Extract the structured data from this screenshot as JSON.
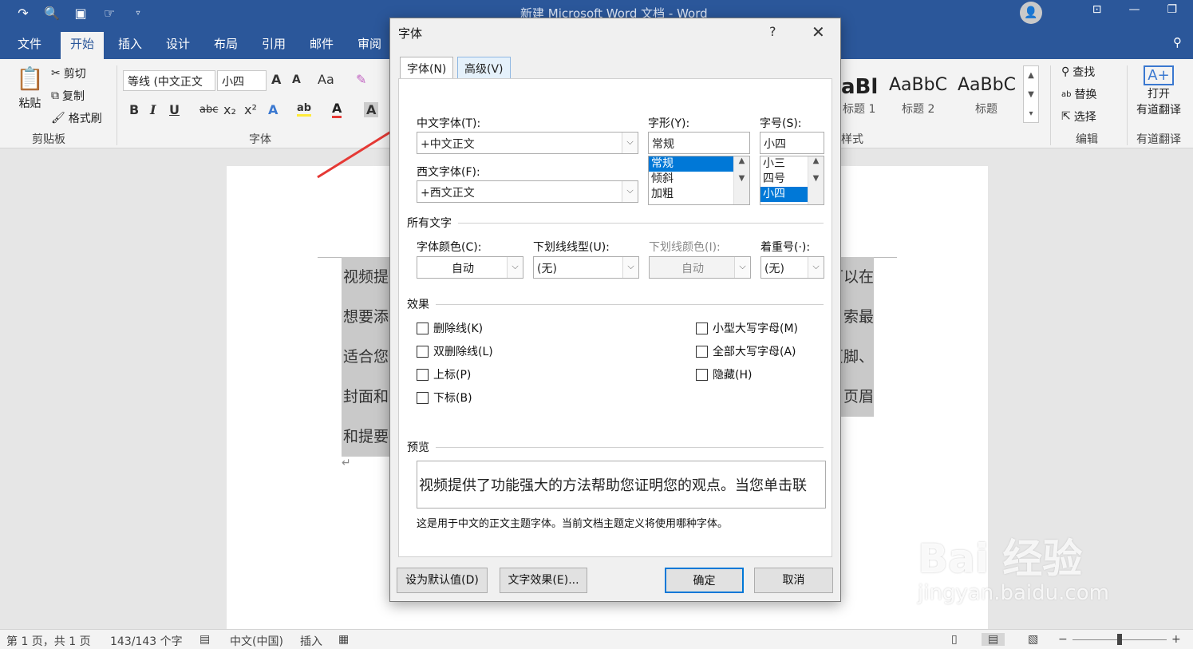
{
  "window": {
    "title": "新建 Microsoft Word 文档  -  Word",
    "qat_icons": [
      "redo-icon",
      "print-preview-icon",
      "save-icon",
      "touch-mode-icon",
      "customize-qat-icon"
    ]
  },
  "ribbon": {
    "tabs": [
      "文件",
      "开始",
      "插入",
      "设计",
      "布局",
      "引用",
      "邮件",
      "审阅"
    ],
    "active_tab": "开始",
    "clipboard": {
      "paste": "粘贴",
      "cut": "剪切",
      "copy": "复制",
      "format_painter": "格式刷",
      "label": "剪贴板"
    },
    "font": {
      "font_name": "等线 (中文正文",
      "font_size": "小四",
      "label": "字体",
      "grow": "A",
      "shrink": "A",
      "case": "Aa",
      "bold": "B",
      "italic": "I",
      "underline": "U",
      "strike": "abc",
      "sub": "x₂",
      "sup": "x²"
    },
    "styles": {
      "label": "样式",
      "items": [
        {
          "sample": "aBl",
          "name": "标题 1"
        },
        {
          "sample": "AaBbC",
          "name": "标题 2"
        },
        {
          "sample": "AaBbC",
          "name": "标题"
        }
      ]
    },
    "editing": {
      "find": "查找",
      "replace": "替换",
      "select": "选择",
      "label": "编辑"
    },
    "youdao": {
      "open_line1": "打开",
      "open_line2": "有道翻译",
      "label": "有道翻译"
    }
  },
  "document": {
    "lines_left": [
      "视频提",
      "想要添",
      "适合您",
      "封面和",
      "和提要"
    ],
    "lines_right": [
      "可以在",
      "索最",
      "页脚、",
      "页眉",
      ""
    ]
  },
  "dialog": {
    "title": "字体",
    "help": "?",
    "close": "✕",
    "tabs": {
      "font": "字体(N)",
      "advanced": "高级(V)"
    },
    "cn_font_label": "中文字体(T):",
    "cn_font_value": "+中文正文",
    "west_font_label": "西文字体(F):",
    "west_font_value": "+西文正文",
    "style_label": "字形(Y):",
    "style_value": "常规",
    "style_options": [
      "常规",
      "倾斜",
      "加粗"
    ],
    "size_label": "字号(S):",
    "size_value": "小四",
    "size_options": [
      "小三",
      "四号",
      "小四"
    ],
    "all_text_section": "所有文字",
    "font_color_label": "字体颜色(C):",
    "font_color_value": "自动",
    "underline_style_label": "下划线线型(U):",
    "underline_style_value": "(无)",
    "underline_color_label": "下划线颜色(I):",
    "underline_color_value": "自动",
    "emphasis_label": "着重号(·):",
    "emphasis_value": "(无)",
    "effects_section": "效果",
    "effects_left": [
      "删除线(K)",
      "双删除线(L)",
      "上标(P)",
      "下标(B)"
    ],
    "effects_right": [
      "小型大写字母(M)",
      "全部大写字母(A)",
      "隐藏(H)"
    ],
    "preview_section": "预览",
    "preview_text": "视频提供了功能强大的方法帮助您证明您的观点。当您单击联",
    "note": "这是用于中文的正文主题字体。当前文档主题定义将使用哪种字体。",
    "buttons": {
      "set_default": "设为默认值(D)",
      "text_effects": "文字效果(E)...",
      "ok": "确定",
      "cancel": "取消"
    }
  },
  "status": {
    "page": "第 1 页，共 1 页",
    "words": "143/143 个字",
    "lang": "中文(中国)",
    "mode": "插入"
  },
  "watermark": {
    "main": "Bai 经验",
    "sub": "jingyan.baidu.com"
  },
  "colors": {
    "word_blue": "#2b579a",
    "selection": "#0078d7",
    "arrow": "#e53935"
  }
}
